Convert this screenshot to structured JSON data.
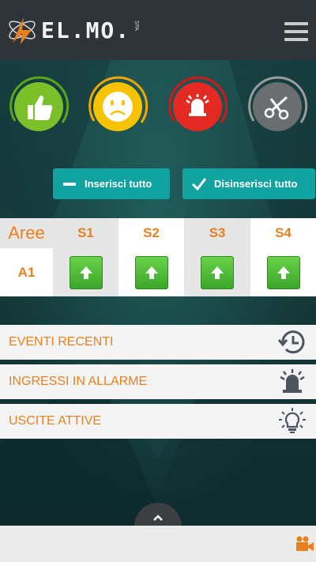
{
  "header": {
    "logo_text": "EL.MO.",
    "logo_suffix": "SPA",
    "menu_icon": "hamburger-menu-icon"
  },
  "status_indicators": [
    {
      "name": "system-ok",
      "icon": "thumbs-up-icon",
      "color": "#7bbf2a",
      "ring": "#5aa61a"
    },
    {
      "name": "warning",
      "icon": "sad-face-icon",
      "color": "#f7c300",
      "ring": "#f0a800"
    },
    {
      "name": "alarm",
      "icon": "alarm-bell-icon",
      "color": "#e32a23",
      "ring": "#d01818"
    },
    {
      "name": "tamper",
      "icon": "scissors-icon",
      "color": "#6b6e70",
      "ring": "#9a9c9e"
    }
  ],
  "actions": {
    "arm_all": "Inserisci tutto",
    "disarm_all": "Disinserisci tutto"
  },
  "areas_table": {
    "header_label": "Aree",
    "columns": [
      "S1",
      "S2",
      "S3",
      "S4"
    ],
    "rows": [
      {
        "label": "A1",
        "cells": [
          "arm-up",
          "arm-up",
          "arm-up",
          "arm-up"
        ]
      }
    ]
  },
  "menu_list": [
    {
      "label": "EVENTI RECENTI",
      "icon": "history-clock-icon"
    },
    {
      "label": "INGRESSI IN ALLARME",
      "icon": "alarm-bell-icon"
    },
    {
      "label": "USCITE ATTIVE",
      "icon": "lightbulb-icon"
    }
  ],
  "colors": {
    "accent_orange": "#e8801d",
    "teal_button": "#10a3a0",
    "header_bg": "#2f3439"
  }
}
